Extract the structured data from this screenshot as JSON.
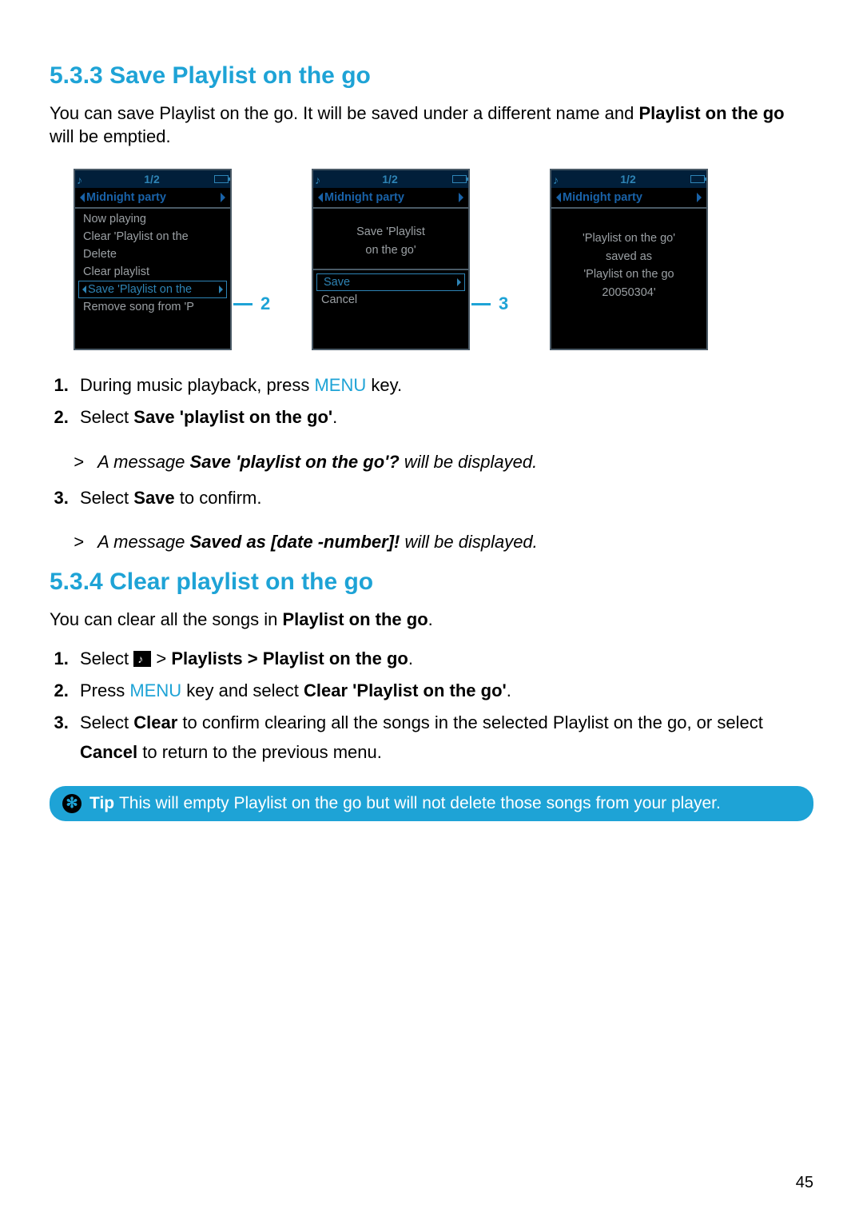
{
  "section1": {
    "number": "5.3.3",
    "title": "Save Playlist on the go",
    "desc_before_bold": "You can save Playlist on the go. It will be saved under a different name and ",
    "desc_bold": "Playlist on the go",
    "desc_after_bold": " will be emptied."
  },
  "screens": {
    "counter": "1/2",
    "title": "Midnight party",
    "screen1": {
      "items": [
        "Now playing",
        "Clear 'Playlist on the",
        "Delete",
        "Clear playlist"
      ],
      "highlight": "Save 'Playlist on the",
      "after": "Remove song from 'P",
      "callout": "2"
    },
    "screen2": {
      "msg_line1": "Save 'Playlist",
      "msg_line2": "on the go'",
      "highlight": "Save",
      "after": "Cancel",
      "callout": "3"
    },
    "screen3": {
      "line1": "'Playlist on the go'",
      "line2": "saved as",
      "line3": "'Playlist on the go",
      "line4": "20050304'"
    }
  },
  "steps1": {
    "s1_before": "During music playback, press ",
    "s1_blue": "MENU",
    "s1_after": " key.",
    "s2_before": "Select ",
    "s2_bold": "Save 'playlist on the go'",
    "s2_after": ".",
    "note_a_before": "A message ",
    "note_a_bold": "Save 'playlist on the go'?",
    "note_a_after": " will be displayed.",
    "s3_before": "Select ",
    "s3_bold": "Save",
    "s3_after": " to confirm.",
    "note_b_before": "A message ",
    "note_b_bold": "Saved as [date -number]!",
    "note_b_after": " will be displayed."
  },
  "section2": {
    "number": "5.3.4",
    "title": "Clear playlist on the go",
    "desc_before_bold": "You can clear all the songs in ",
    "desc_bold": "Playlist on the go",
    "desc_after_bold": "."
  },
  "steps2": {
    "s1_before": "Select ",
    "s1_after_icon": " > ",
    "s1_bold": "Playlists > Playlist on the go",
    "s1_end": ".",
    "s2_before": "Press ",
    "s2_blue": "MENU",
    "s2_mid": " key and select ",
    "s2_bold": "Clear 'Playlist on the go'",
    "s2_end": ".",
    "s3_before": "Select ",
    "s3_bold1": "Clear",
    "s3_mid": " to confirm clearing all the songs in the selected Playlist on the go, or select ",
    "s3_bold2": "Cancel",
    "s3_end": " to return to the previous menu."
  },
  "tip": {
    "label": "Tip",
    "text": "This will empty Playlist on the go but will not delete those songs from your player."
  },
  "page_number": "45"
}
